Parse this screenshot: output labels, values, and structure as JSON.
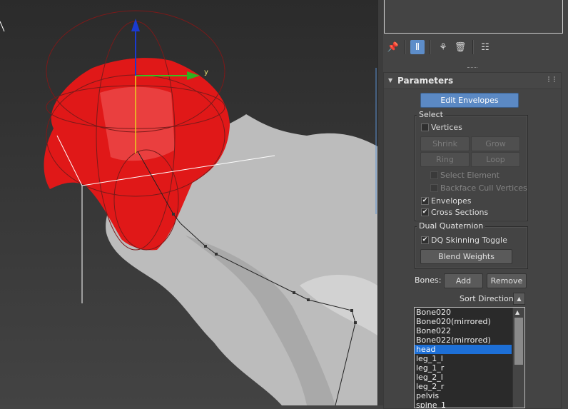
{
  "viewport": {
    "gizmo_y_label": "y"
  },
  "toolbar": {
    "icons": [
      "pin-stack-icon",
      "show-end-result-icon",
      "make-unique-icon",
      "remove-modifier-icon",
      "configure-modifier-sets-icon"
    ]
  },
  "parameters": {
    "title": "Parameters",
    "edit_envelopes": "Edit Envelopes",
    "select": {
      "label": "Select",
      "vertices": "Vertices",
      "shrink": "Shrink",
      "grow": "Grow",
      "ring": "Ring",
      "loop": "Loop",
      "select_element": "Select Element",
      "backface_cull": "Backface Cull Vertices",
      "envelopes": "Envelopes",
      "cross_sections": "Cross Sections"
    },
    "dual_quaternion": {
      "label": "Dual Quaternion",
      "dq_toggle": "DQ Skinning Toggle",
      "blend_weights": "Blend Weights"
    },
    "bones_label": "Bones:",
    "add": "Add",
    "remove": "Remove",
    "sort_direction": "Sort Direction:",
    "bones": [
      "Bone020",
      "Bone020(mirrored)",
      "Bone022",
      "Bone022(mirrored)",
      "head",
      "leg_1_l",
      "leg_1_r",
      "leg_2_l",
      "leg_2_r",
      "pelvis",
      "spine_1"
    ],
    "selected_bone": "head"
  },
  "colors": {
    "envelope_red": "#e01818",
    "selection_blue": "#1d6fd6",
    "button_blue": "#5b89c4"
  }
}
